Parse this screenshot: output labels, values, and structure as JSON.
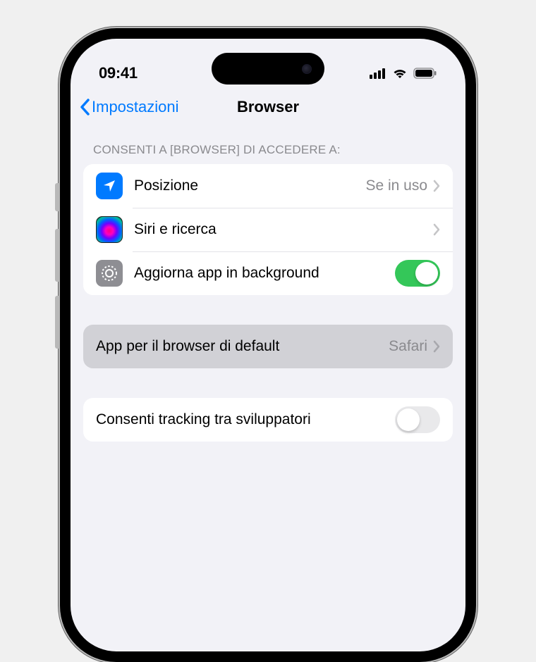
{
  "status": {
    "time": "09:41"
  },
  "nav": {
    "back": "Impostazioni",
    "title": "Browser"
  },
  "section1": {
    "header": "CONSENTI A [BROWSER] DI ACCEDERE A:",
    "rows": {
      "location": {
        "label": "Posizione",
        "value": "Se in uso"
      },
      "siri": {
        "label": "Siri e ricerca"
      },
      "bg": {
        "label": "Aggiorna app in background",
        "toggle": true
      }
    }
  },
  "section2": {
    "default": {
      "label": "App per il browser di default",
      "value": "Safari"
    }
  },
  "section3": {
    "tracking": {
      "label": "Consenti tracking tra sviluppatori",
      "toggle": false
    }
  }
}
